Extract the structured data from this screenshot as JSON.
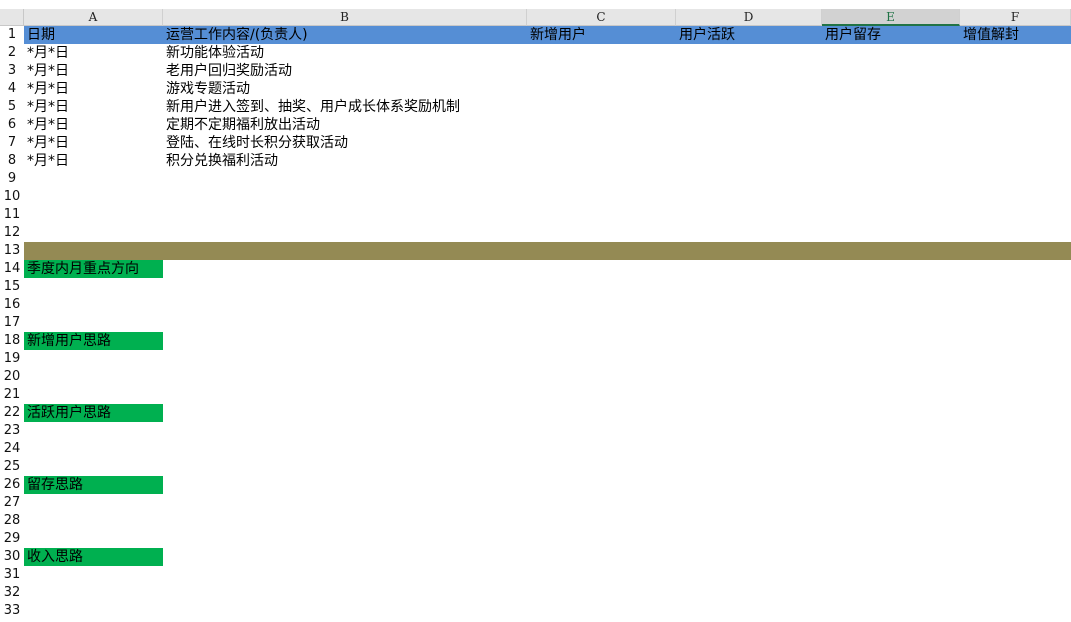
{
  "columns": [
    "A",
    "B",
    "C",
    "D",
    "E",
    "F"
  ],
  "row_numbers": [
    "1",
    "2",
    "3",
    "4",
    "5",
    "6",
    "7",
    "8",
    "9",
    "10",
    "11",
    "12",
    "13",
    "14",
    "15",
    "16",
    "17",
    "18",
    "19",
    "20",
    "21",
    "22",
    "23",
    "24",
    "25",
    "26",
    "27",
    "28",
    "29",
    "30",
    "31",
    "32",
    "33"
  ],
  "header_row": {
    "a": "日期",
    "b": "运营工作内容/(负责人)",
    "c": "新增用户",
    "d": "用户活跃",
    "e": "用户留存",
    "f": "增值解封"
  },
  "rows": [
    {
      "date": "*月*日",
      "content": "新功能体验活动"
    },
    {
      "date": "*月*日",
      "content": "老用户回归奖励活动"
    },
    {
      "date": "*月*日",
      "content": "游戏专题活动"
    },
    {
      "date": "*月*日",
      "content": "新用户进入签到、抽奖、用户成长体系奖励机制"
    },
    {
      "date": "*月*日",
      "content": "定期不定期福利放出活动"
    },
    {
      "date": "*月*日",
      "content": "登陆、在线时长积分获取活动"
    },
    {
      "date": "*月*日",
      "content": "积分兑换福利活动"
    }
  ],
  "sections": {
    "quarter_focus": "季度内月重点方向",
    "new_users": "新增用户思路",
    "active_users": "活跃用户思路",
    "retention": "留存思路",
    "revenue": "收入思路"
  },
  "colors": {
    "header_band": "#558ed5",
    "separator_band": "#948a54",
    "section_label": "#00b050",
    "selected_column": "#217346"
  }
}
